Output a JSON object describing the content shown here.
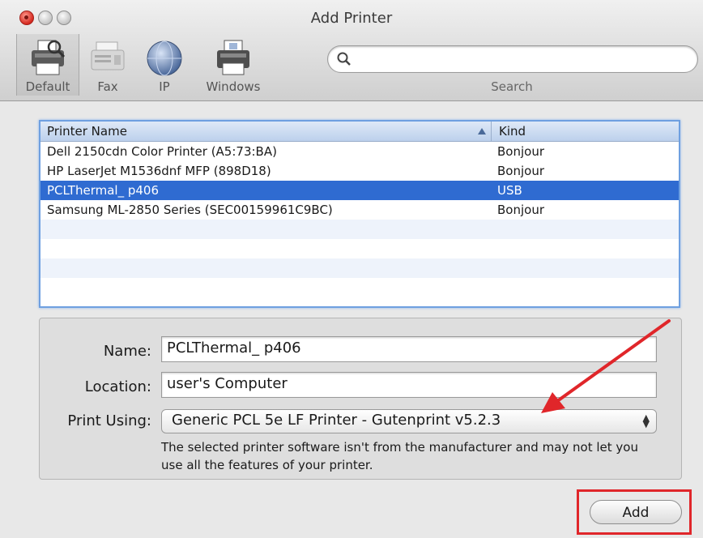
{
  "window": {
    "title": "Add Printer"
  },
  "toolbar": {
    "items": [
      {
        "label": "Default",
        "icon": "printer-icon",
        "selected": true
      },
      {
        "label": "Fax",
        "icon": "fax-icon",
        "selected": false
      },
      {
        "label": "IP",
        "icon": "globe-icon",
        "selected": false
      },
      {
        "label": "Windows",
        "icon": "windows-printer-icon",
        "selected": false
      }
    ],
    "search": {
      "label": "Search",
      "value": "",
      "placeholder": ""
    }
  },
  "printer_table": {
    "columns": [
      "Printer Name",
      "Kind"
    ],
    "rows": [
      {
        "name": "Dell 2150cdn Color Printer (A5:73:BA)",
        "kind": "Bonjour"
      },
      {
        "name": "HP LaserJet M1536dnf MFP (898D18)",
        "kind": "Bonjour"
      },
      {
        "name": "PCLThermal_ p406",
        "kind": "USB",
        "selected": true
      },
      {
        "name": "Samsung ML-2850 Series (SEC00159961C9BC)",
        "kind": "Bonjour"
      }
    ]
  },
  "details": {
    "name_label": "Name:",
    "name_value": "PCLThermal_ p406",
    "location_label": "Location:",
    "location_value": "user's Computer",
    "print_using_label": "Print Using:",
    "print_using_value": "Generic PCL 5e LF Printer - Gutenprint v5.2.3",
    "note": "The selected printer software isn't from the manufacturer and may not let you use all the features of your printer."
  },
  "actions": {
    "add_label": "Add"
  },
  "colors": {
    "selection": "#2f6bd1",
    "annotation_red": "#e0262a"
  }
}
